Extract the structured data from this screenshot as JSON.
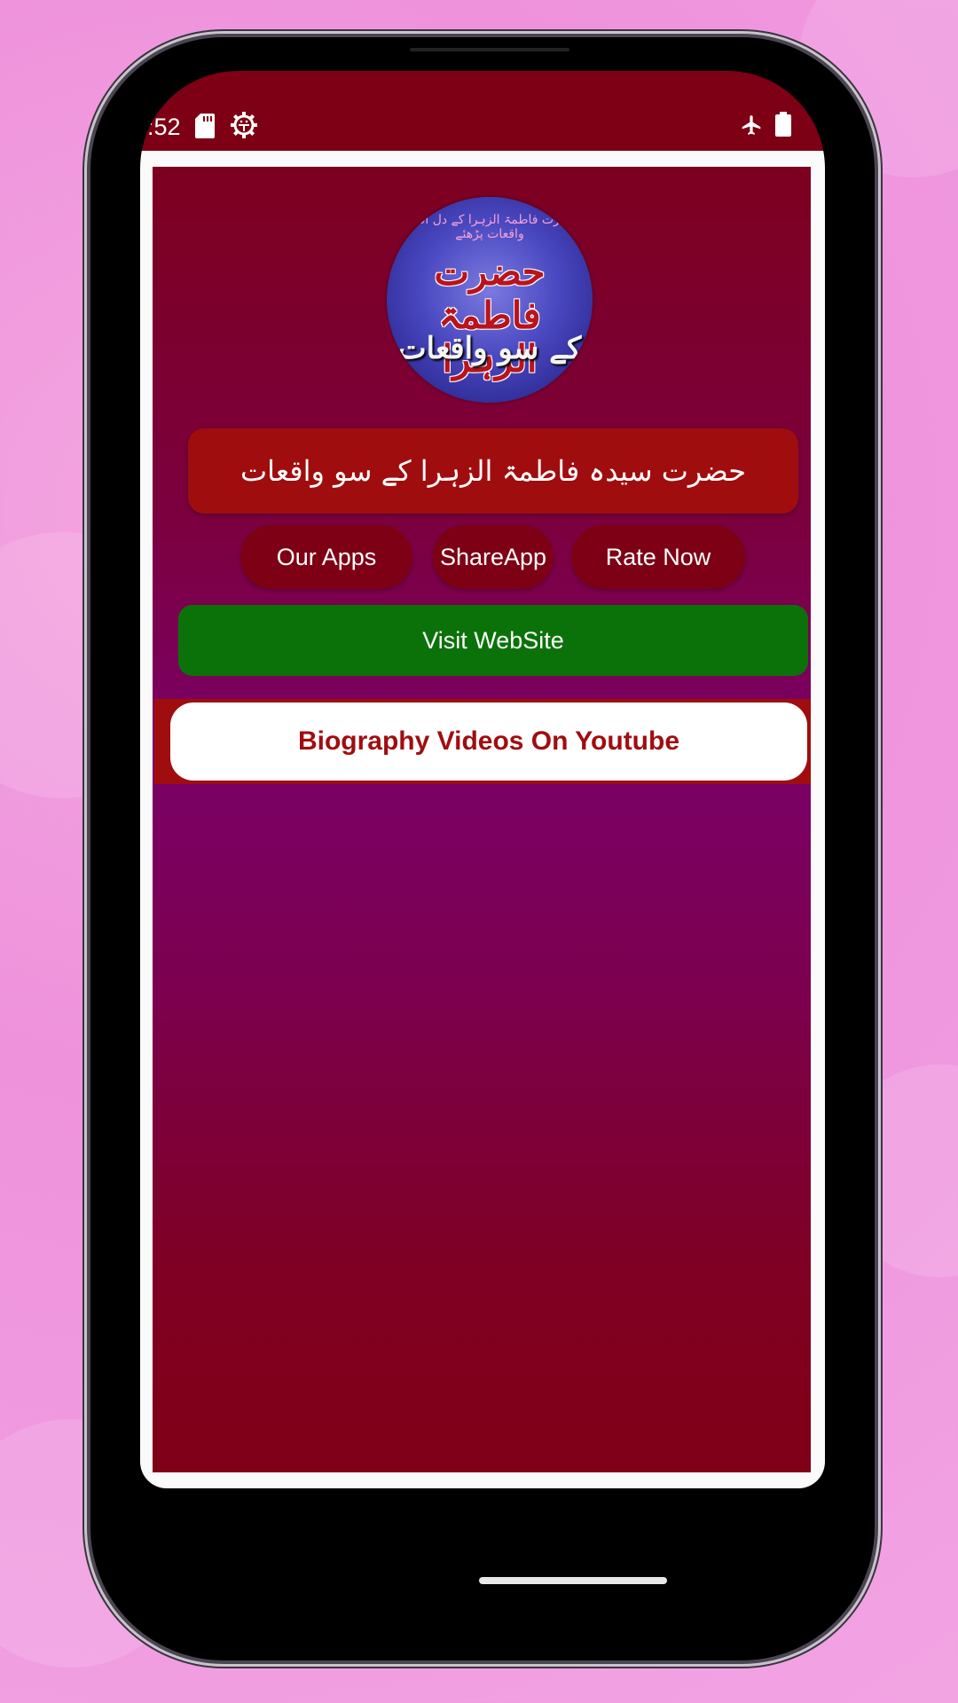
{
  "status_bar": {
    "time": ":52",
    "left_icons": [
      "sd-card-icon",
      "debug-gear-icon"
    ],
    "right_icons": [
      "airplane-mode-icon",
      "battery-icon"
    ]
  },
  "app": {
    "logo": {
      "top_text": "حضرت فاطمۃ الزہرا کے دل افروز واقعات پڑھئے",
      "main_text": "حضرت فاطمۃ الزہرا",
      "bottom_text": "کے سو واقعات"
    },
    "title": "حضرت سیدہ فاطمۃ الزہرا کے سو واقعات",
    "buttons": {
      "our_apps": "Our Apps",
      "share_app": "ShareApp",
      "rate_now": "Rate Now",
      "visit_website": "Visit WebSite",
      "youtube": "Biography Videos On Youtube"
    }
  },
  "colors": {
    "status_bar": "#7d0014",
    "title_banner": "#a00d0e",
    "pill_button": "#7e0014",
    "visit_button": "#0b720a",
    "youtube_text": "#a00d10",
    "background_pink": "#ee92dc"
  }
}
